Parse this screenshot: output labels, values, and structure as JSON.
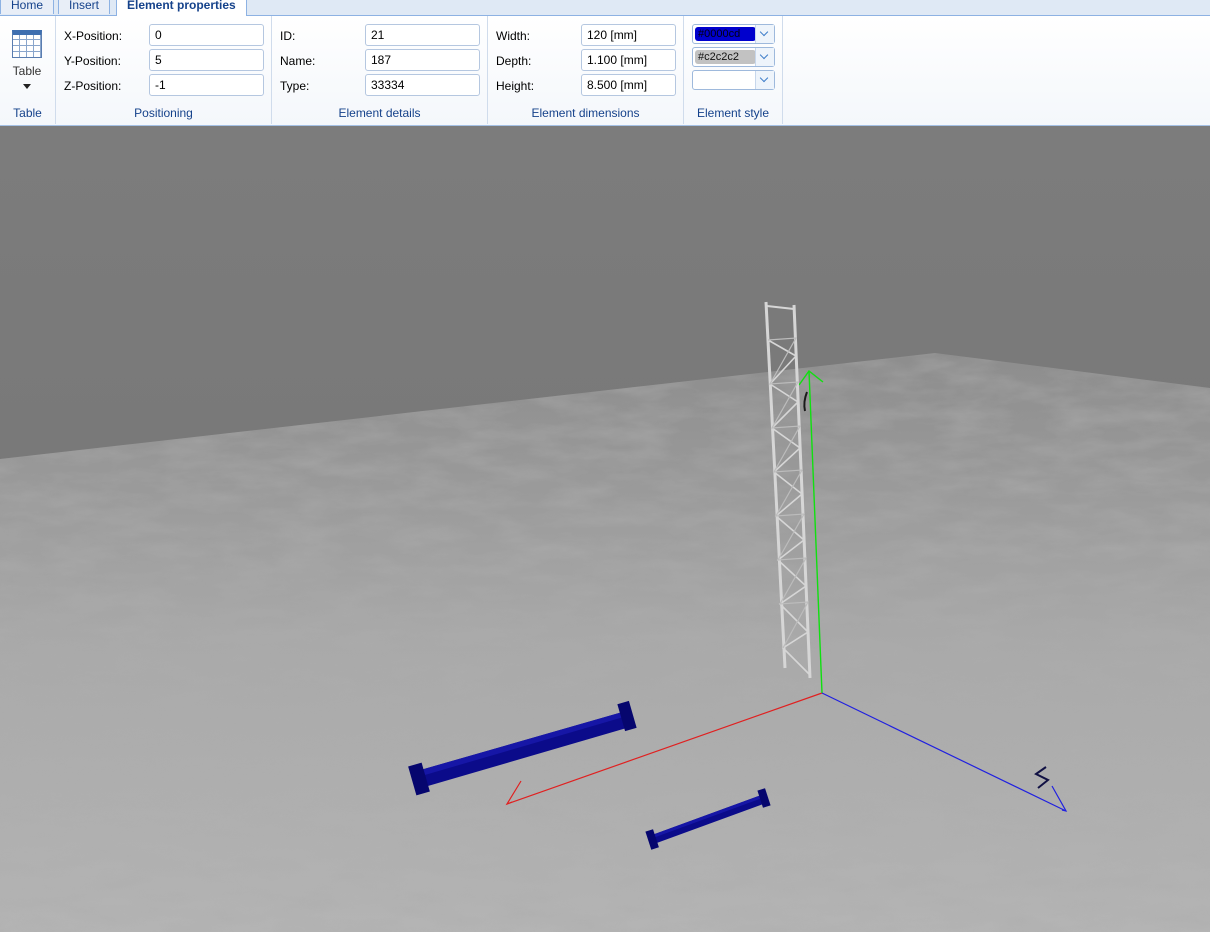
{
  "tabs": [
    {
      "label": "Home"
    },
    {
      "label": "Insert"
    },
    {
      "label": "Element properties"
    }
  ],
  "ribbon": {
    "table_group": {
      "button_label": "Table",
      "group_label": "Table"
    },
    "positioning": {
      "group_label": "Positioning",
      "x_label": "X-Position:",
      "x_value": "0",
      "y_label": "Y-Position:",
      "y_value": "5",
      "z_label": "Z-Position:",
      "z_value": "-1"
    },
    "details": {
      "group_label": "Element details",
      "id_label": "ID:",
      "id_value": "21",
      "name_label": "Name:",
      "name_value": "187",
      "type_label": "Type:",
      "type_value": "33334"
    },
    "dimensions": {
      "group_label": "Element dimensions",
      "width_label": "Width:",
      "width_value": "120 [mm]",
      "depth_label": "Depth:",
      "depth_value": "1.100 [mm]",
      "height_label": "Height:",
      "height_value": "8.500 [mm]"
    },
    "style": {
      "group_label": "Element style",
      "color1": "#0000cd",
      "color2": "#c2c2c2",
      "color1_label": "#0000cd",
      "color2_label": "#c2c2c2"
    }
  },
  "scene": {
    "axis_colors": {
      "x": "#e02020",
      "y": "#10e010",
      "z": "#2020e0"
    },
    "beam_color": "#0b0b8a",
    "truss_color": "#d8d8d8"
  }
}
